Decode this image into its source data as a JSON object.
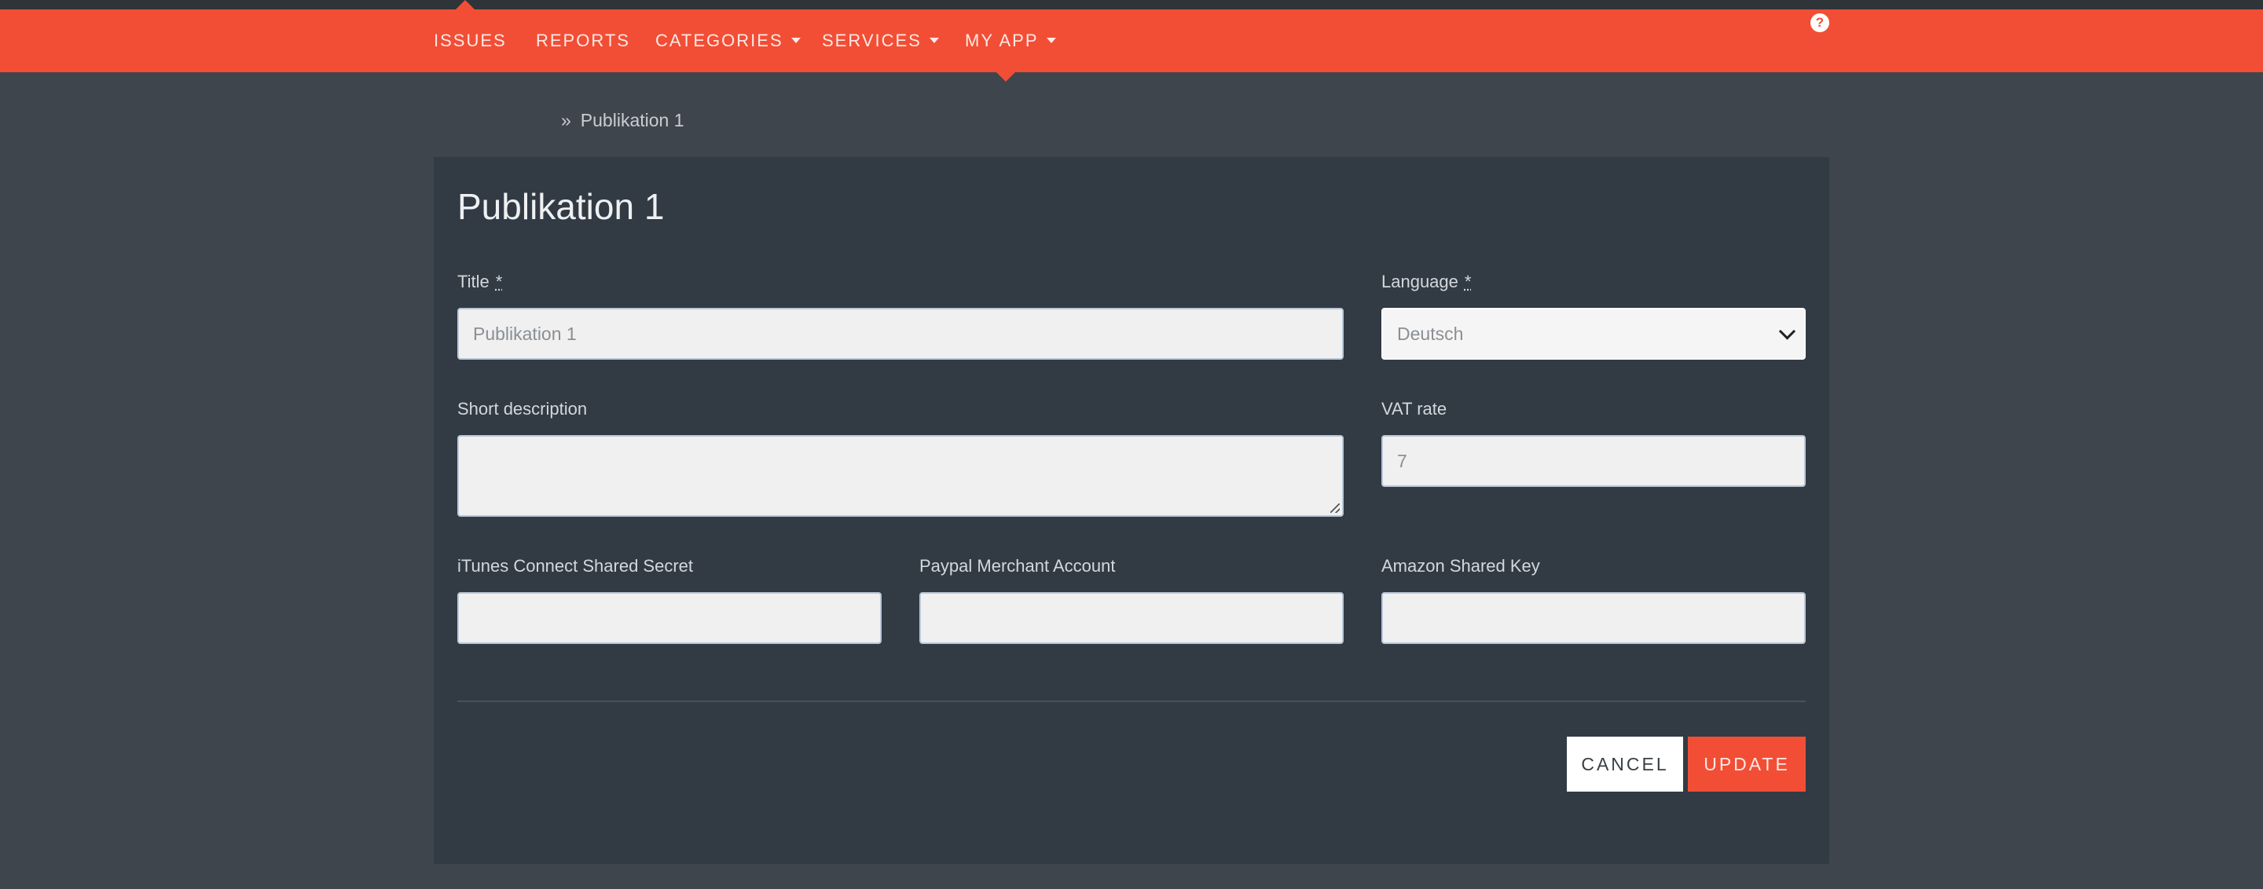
{
  "nav": {
    "items": [
      {
        "label": "ISSUES"
      },
      {
        "label": "REPORTS"
      },
      {
        "label": "CATEGORIES"
      },
      {
        "label": "SERVICES"
      },
      {
        "label": "MY APP"
      }
    ],
    "help_icon": "question-circle-icon"
  },
  "breadcrumb": {
    "separator": "»",
    "current": "Publikation 1"
  },
  "form": {
    "page_title": "Publikation 1",
    "required_marker": "*",
    "title": {
      "label": "Title",
      "value": "Publikation 1"
    },
    "language": {
      "label": "Language",
      "value": "Deutsch"
    },
    "short_description": {
      "label": "Short description",
      "value": ""
    },
    "vat_rate": {
      "label": "VAT rate",
      "value": "7"
    },
    "itunes_secret": {
      "label": "iTunes Connect Shared Secret",
      "value": ""
    },
    "paypal_account": {
      "label": "Paypal Merchant Account",
      "value": ""
    },
    "amazon_key": {
      "label": "Amazon Shared Key",
      "value": ""
    }
  },
  "actions": {
    "cancel_label": "CANCEL",
    "update_label": "UPDATE"
  },
  "colors": {
    "accent": "#f24e35",
    "background": "#3e454d",
    "panel": "#323b44"
  }
}
